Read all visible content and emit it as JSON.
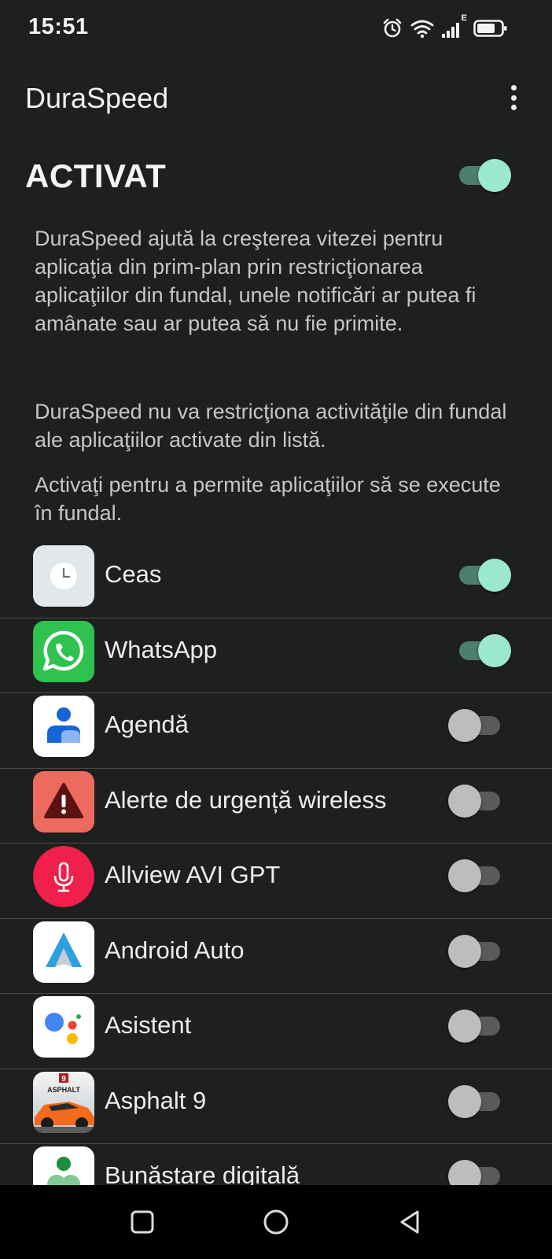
{
  "status_bar": {
    "time": "15:51",
    "icons": [
      "alarm-icon",
      "wifi-icon",
      "signal-icon",
      "battery-icon"
    ],
    "network_type": "E"
  },
  "app_bar": {
    "title": "DuraSpeed",
    "menu_icon": "more-vert-icon"
  },
  "master_switch": {
    "label": "ACTIVAT",
    "on": true
  },
  "descriptions": {
    "intro": "DuraSpeed ajută la creşterea vitezei pentru aplicaţia din prim-plan prin restricţionarea aplicaţiilor din fundal, unele notificări ar putea fi amânate sau ar putea să nu fie primite.",
    "note": "DuraSpeed nu va restricţiona activităţile din fundal ale aplicaţiilor activate din listă.",
    "instruction": "Activaţi pentru a permite aplicaţiilor să se execute în fundal."
  },
  "apps": [
    {
      "name": "Ceas",
      "icon": "clock-icon",
      "enabled": true
    },
    {
      "name": "WhatsApp",
      "icon": "whatsapp-icon",
      "enabled": true
    },
    {
      "name": "Agendă",
      "icon": "contacts-icon",
      "enabled": false
    },
    {
      "name": "Alerte de urgență wireless",
      "icon": "emergency-alert-icon",
      "enabled": false
    },
    {
      "name": "Allview AVI GPT",
      "icon": "microphone-icon",
      "enabled": false
    },
    {
      "name": "Android Auto",
      "icon": "android-auto-icon",
      "enabled": false
    },
    {
      "name": "Asistent",
      "icon": "assistant-icon",
      "enabled": false
    },
    {
      "name": "Asphalt 9",
      "icon": "asphalt-game-icon",
      "enabled": false
    },
    {
      "name": "Bunăstare digitală",
      "icon": "digital-wellbeing-icon",
      "enabled": false
    }
  ],
  "asphalt_logo_text": "ASPHALT",
  "asphalt_logo_number": "9",
  "colors": {
    "background": "#1e1f1f",
    "switch_on_thumb": "#9ce7cf",
    "switch_on_track": "#4e7e6f",
    "switch_off_thumb": "#bdbdbd",
    "switch_off_track": "#5a5a5a",
    "divider": "#4a4a4a"
  },
  "nav_bar": {
    "buttons": [
      "recents-icon",
      "home-icon",
      "back-icon"
    ]
  }
}
